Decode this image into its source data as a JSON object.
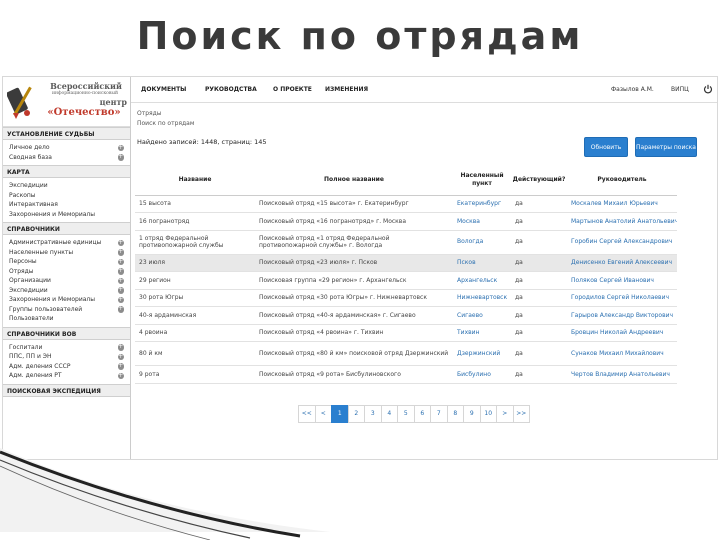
{
  "slide": {
    "title": "Поиск по отрядам"
  },
  "logo": {
    "line1": "Всероссийский",
    "line2": "информационно-поисковый",
    "line3": "центр",
    "line4": "«Отечество»"
  },
  "sidebar": {
    "sections": [
      {
        "title": "УСТАНОВЛЕНИЕ СУДЬБЫ",
        "items": [
          {
            "label": "Личное дело",
            "plus": true
          },
          {
            "label": "Сводная база",
            "plus": true
          }
        ]
      },
      {
        "title": "КАРТА",
        "items": [
          {
            "label": "Экспедиции",
            "plus": false
          },
          {
            "label": "Раскопы",
            "plus": false
          },
          {
            "label": "Интерактивная",
            "plus": false
          },
          {
            "label": "Захоронения и Мемориалы",
            "plus": false
          }
        ]
      },
      {
        "title": "СПРАВОЧНИКИ",
        "items": [
          {
            "label": "Административные единицы",
            "plus": true
          },
          {
            "label": "Населенные пункты",
            "plus": true
          },
          {
            "label": "Персоны",
            "plus": true
          },
          {
            "label": "Отряды",
            "plus": true
          },
          {
            "label": "Организации",
            "plus": true
          },
          {
            "label": "Экспедиции",
            "plus": true
          },
          {
            "label": "Захоронения и Мемориалы",
            "plus": true
          },
          {
            "label": "Группы пользователей",
            "plus": true
          },
          {
            "label": "Пользователи",
            "plus": false
          }
        ]
      },
      {
        "title": "СПРАВОЧНИКИ ВОВ",
        "items": [
          {
            "label": "Госпитали",
            "plus": true
          },
          {
            "label": "ППС, ПП и ЭН",
            "plus": true
          },
          {
            "label": "Адм. деления СССР",
            "plus": true
          },
          {
            "label": "Адм. деления РТ",
            "plus": true
          }
        ]
      },
      {
        "title": "ПОИСКОВАЯ ЭКСПЕДИЦИЯ",
        "items": []
      }
    ]
  },
  "topnav": {
    "items": [
      "ДОКУМЕНТЫ",
      "РУКОВОДСТВА",
      "О ПРОЕКТЕ",
      "ИЗМЕНЕНИЯ"
    ],
    "user": "Фазылов А.М.",
    "org": "ВИПЦ"
  },
  "breadcrumbs": {
    "line1": "Отряды",
    "line2": "Поиск по отрядам"
  },
  "found_text": "Найдено записей: 1448, страниц: 145",
  "buttons": {
    "refresh": "Обновить",
    "search_params": "Параметры поиска"
  },
  "table": {
    "headers": [
      "Название",
      "Полное название",
      "Населенный пункт",
      "Действующий?",
      "Руководитель"
    ],
    "rows": [
      [
        "15 высота",
        "Поисковый отряд «15 высота» г. Екатеринбург",
        "Екатеринбург",
        "да",
        "Москалев Михаил Юрьевич"
      ],
      [
        "16 погранотряд",
        "Поисковый отряд «16 погранотряд» г. Москва",
        "Москва",
        "да",
        "Мартынов Анатолий Анатольевич"
      ],
      [
        "1 отряд Федеральной противопожарной службы",
        "Поисковый отряд «1 отряд Федеральной противопожарной службы» г. Вологда",
        "Вологда",
        "да",
        "Горобин Сергей Александрович"
      ],
      [
        "23 июля",
        "Поисковый отряд «23 июля» г. Псков",
        "Псков",
        "да",
        "Денисенко Евгений Алексеевич"
      ],
      [
        "29 регион",
        "Поисковая группа «29 регион» г. Архангельск",
        "Архангельск",
        "да",
        "Поляков Сергей Иванович"
      ],
      [
        "30 рота Югры",
        "Поисковый отряд «30 рота Югры» г. Нижневартовск",
        "Нижневартовск",
        "да",
        "Городилов Сергей Николаевич"
      ],
      [
        "40-я ардаминская",
        "Поисковый отряд «40-я ардаминская» г. Сигаево",
        "Сигаево",
        "да",
        "Гарыров Александр Викторович"
      ],
      [
        "4 рвоина",
        "Поисковый отряд «4 рвоина» г. Тихвин",
        "Тихвин",
        "да",
        "Бровцин Николай Андреевич"
      ],
      [
        "80 й км",
        "Поисковый отряд «80 й км» поисковой отряд Дзержинский",
        "Дзержинский",
        "да",
        "Сунаков Михаил Михайлович"
      ],
      [
        "9 рота",
        "Поисковый отряд «9 рота» Бисбулиновского",
        "Бисбулино",
        "да",
        "Чертов Владимир Анатольевич"
      ]
    ],
    "highlighted_row": 3
  },
  "pagination": [
    "<<",
    "<",
    "1",
    "2",
    "3",
    "4",
    "5",
    "6",
    "7",
    "8",
    "9",
    "10",
    ">",
    ">>"
  ],
  "pagination_active": "1",
  "colors": {
    "accent": "#2a7fcf",
    "link": "#2a6fb0",
    "brand": "#c0392b"
  }
}
